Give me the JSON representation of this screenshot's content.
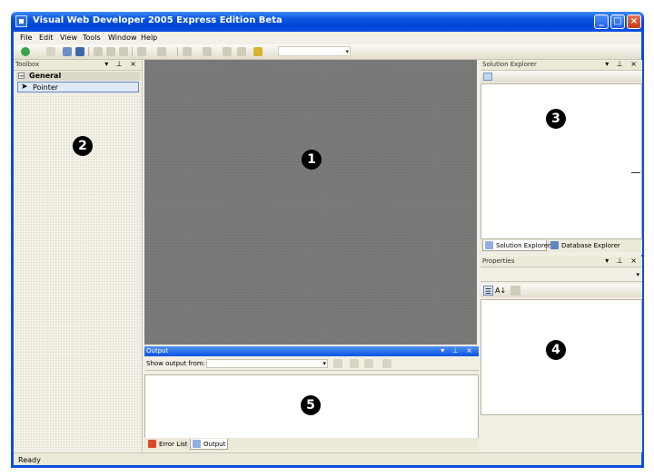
{
  "window": {
    "title": "Visual Web Developer 2005 Express Edition Beta",
    "min_glyph": "_",
    "max_glyph": "□",
    "close_glyph": "×"
  },
  "menu": [
    "File",
    "Edit",
    "View",
    "Tools",
    "Window",
    "Help"
  ],
  "panel_buttons": "▾ ⊥ ×",
  "toolbox": {
    "title": "Toolbox",
    "group": "General",
    "group_toggle": "−",
    "item": "Pointer",
    "item_icon": "arrow-pointer-icon"
  },
  "output": {
    "title": "Output",
    "show_from_label": "Show output from:",
    "source_value": "",
    "dropdown_glyph": "▾",
    "tabs": [
      {
        "label": "Error List",
        "icon": "error-list-icon"
      },
      {
        "label": "Output",
        "icon": "output-icon"
      }
    ]
  },
  "solution_explorer": {
    "title": "Solution Explorer",
    "tabs": [
      {
        "label": "Solution Explorer",
        "icon": "solution-explorer-icon"
      },
      {
        "label": "Database Explorer",
        "icon": "database-explorer-icon"
      }
    ]
  },
  "properties": {
    "title": "Properties",
    "dropdown_glyph": "▾",
    "toolbar_icons": [
      "categorized-icon",
      "alphabetical-icon",
      "property-pages-icon"
    ],
    "alpha_glyph": "A↓"
  },
  "status": {
    "text": "Ready"
  },
  "markers": {
    "editor": "1",
    "toolbox": "2",
    "solution": "3",
    "properties": "4",
    "output": "5"
  },
  "colors": {
    "title_bar": "#0a55e0",
    "editor_bg": "#7a7a7a",
    "panel_bg": "#f1efe4"
  }
}
